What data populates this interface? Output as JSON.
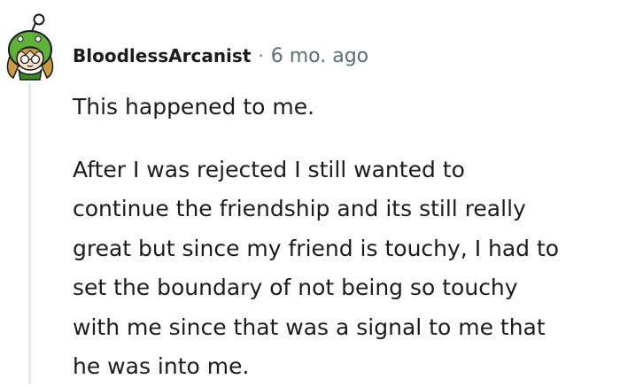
{
  "comment": {
    "author": "BloodlessArcanist",
    "separator": "·",
    "timestamp": "6 mo. ago",
    "paragraphs": [
      {
        "lines": [
          "This happened to me."
        ]
      },
      {
        "lines": [
          "After I was rejected I still wanted to",
          "continue the friendship and its still really",
          "great but since my friend is touchy, I had to",
          "set the boundary of not being so touchy",
          "with me since that was a signal to me that",
          "he was into me."
        ]
      }
    ]
  },
  "colors": {
    "avatar_green": "#5fb139",
    "avatar_dark_green": "#3c8a24",
    "hair": "#c99a44",
    "text_primary": "#1c1c1c",
    "text_secondary": "#576f76",
    "thread_line": "#e5e8ea"
  },
  "icons": {
    "avatar": "snoo-avatar-green-hood"
  }
}
